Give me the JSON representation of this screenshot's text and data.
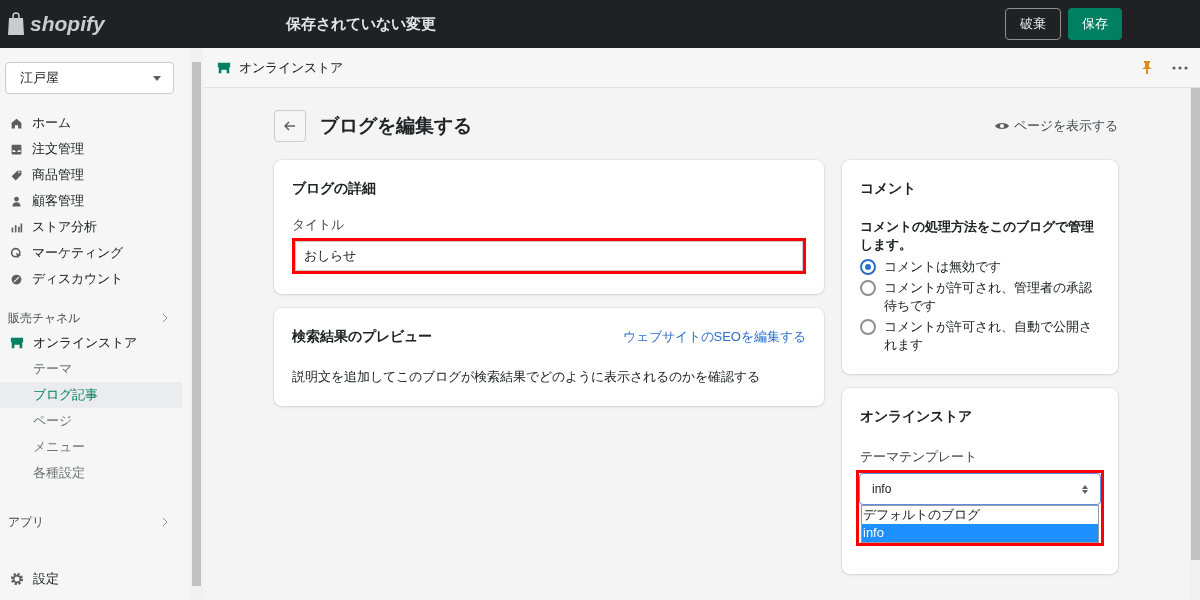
{
  "topbar": {
    "logo": "shopify",
    "title": "保存されていない変更",
    "discard": "破棄",
    "save": "保存"
  },
  "sidebar": {
    "store": "江戸屋",
    "nav": [
      {
        "kind": "home",
        "label": "ホーム"
      },
      {
        "kind": "inbox",
        "label": "注文管理"
      },
      {
        "kind": "tag",
        "label": "商品管理"
      },
      {
        "kind": "person",
        "label": "顧客管理"
      },
      {
        "kind": "bars",
        "label": "ストア分析"
      },
      {
        "kind": "target",
        "label": "マーケティング"
      },
      {
        "kind": "discount",
        "label": "ディスカウント"
      }
    ],
    "channels_heading": "販売チャネル",
    "channel": {
      "label": "オンラインストア",
      "children": [
        {
          "label": "テーマ",
          "selected": false
        },
        {
          "label": "ブログ記事",
          "selected": true
        },
        {
          "label": "ページ",
          "selected": false
        },
        {
          "label": "メニュー",
          "selected": false
        },
        {
          "label": "各種設定",
          "selected": false
        }
      ]
    },
    "apps_heading": "アプリ",
    "settings": "設定"
  },
  "header": {
    "title": "オンラインストア"
  },
  "page": {
    "title": "ブログを編集する",
    "view_link": "ページを表示する"
  },
  "details": {
    "heading": "ブログの詳細",
    "field_label": "タイトル",
    "value": "おしらせ",
    "highlighted": true
  },
  "seo": {
    "heading": "検索結果のプレビュー",
    "link": "ウェブサイトのSEOを編集する",
    "text": "説明文を追加してこのブログが検索結果でどのように表示されるのかを確認する"
  },
  "comments": {
    "heading": "コメント",
    "description": "コメントの処理方法をこのブログで管理します。",
    "options": [
      {
        "label": "コメントは無効です",
        "selected": true
      },
      {
        "label": "コメントが許可され、管理者の承認待ちです",
        "selected": false
      },
      {
        "label": "コメントが許可され、自動で公開されます",
        "selected": false
      }
    ]
  },
  "store": {
    "heading": "オンラインストア",
    "field_label": "テーマテンプレート",
    "value": "info",
    "highlighted": true,
    "options": [
      {
        "label": "デフォルトのブログ",
        "selected": false
      },
      {
        "label": "info",
        "selected": true
      }
    ]
  }
}
